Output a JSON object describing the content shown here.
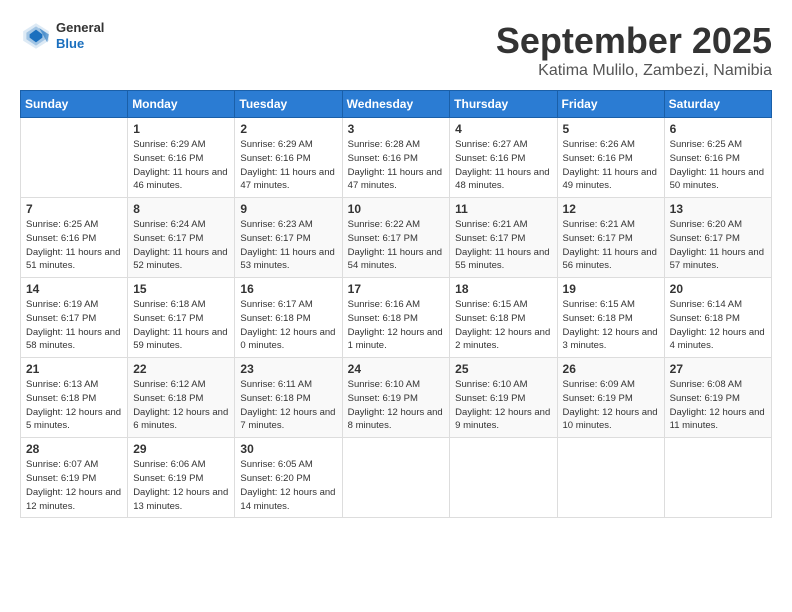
{
  "header": {
    "logo": {
      "general": "General",
      "blue": "Blue"
    },
    "title": "September 2025",
    "subtitle": "Katima Mulilo, Zambezi, Namibia"
  },
  "columns": [
    "Sunday",
    "Monday",
    "Tuesday",
    "Wednesday",
    "Thursday",
    "Friday",
    "Saturday"
  ],
  "weeks": [
    [
      {
        "day": "",
        "sunrise": "",
        "sunset": "",
        "daylight": ""
      },
      {
        "day": "1",
        "sunrise": "Sunrise: 6:29 AM",
        "sunset": "Sunset: 6:16 PM",
        "daylight": "Daylight: 11 hours and 46 minutes."
      },
      {
        "day": "2",
        "sunrise": "Sunrise: 6:29 AM",
        "sunset": "Sunset: 6:16 PM",
        "daylight": "Daylight: 11 hours and 47 minutes."
      },
      {
        "day": "3",
        "sunrise": "Sunrise: 6:28 AM",
        "sunset": "Sunset: 6:16 PM",
        "daylight": "Daylight: 11 hours and 47 minutes."
      },
      {
        "day": "4",
        "sunrise": "Sunrise: 6:27 AM",
        "sunset": "Sunset: 6:16 PM",
        "daylight": "Daylight: 11 hours and 48 minutes."
      },
      {
        "day": "5",
        "sunrise": "Sunrise: 6:26 AM",
        "sunset": "Sunset: 6:16 PM",
        "daylight": "Daylight: 11 hours and 49 minutes."
      },
      {
        "day": "6",
        "sunrise": "Sunrise: 6:25 AM",
        "sunset": "Sunset: 6:16 PM",
        "daylight": "Daylight: 11 hours and 50 minutes."
      }
    ],
    [
      {
        "day": "7",
        "sunrise": "Sunrise: 6:25 AM",
        "sunset": "Sunset: 6:16 PM",
        "daylight": "Daylight: 11 hours and 51 minutes."
      },
      {
        "day": "8",
        "sunrise": "Sunrise: 6:24 AM",
        "sunset": "Sunset: 6:17 PM",
        "daylight": "Daylight: 11 hours and 52 minutes."
      },
      {
        "day": "9",
        "sunrise": "Sunrise: 6:23 AM",
        "sunset": "Sunset: 6:17 PM",
        "daylight": "Daylight: 11 hours and 53 minutes."
      },
      {
        "day": "10",
        "sunrise": "Sunrise: 6:22 AM",
        "sunset": "Sunset: 6:17 PM",
        "daylight": "Daylight: 11 hours and 54 minutes."
      },
      {
        "day": "11",
        "sunrise": "Sunrise: 6:21 AM",
        "sunset": "Sunset: 6:17 PM",
        "daylight": "Daylight: 11 hours and 55 minutes."
      },
      {
        "day": "12",
        "sunrise": "Sunrise: 6:21 AM",
        "sunset": "Sunset: 6:17 PM",
        "daylight": "Daylight: 11 hours and 56 minutes."
      },
      {
        "day": "13",
        "sunrise": "Sunrise: 6:20 AM",
        "sunset": "Sunset: 6:17 PM",
        "daylight": "Daylight: 11 hours and 57 minutes."
      }
    ],
    [
      {
        "day": "14",
        "sunrise": "Sunrise: 6:19 AM",
        "sunset": "Sunset: 6:17 PM",
        "daylight": "Daylight: 11 hours and 58 minutes."
      },
      {
        "day": "15",
        "sunrise": "Sunrise: 6:18 AM",
        "sunset": "Sunset: 6:17 PM",
        "daylight": "Daylight: 11 hours and 59 minutes."
      },
      {
        "day": "16",
        "sunrise": "Sunrise: 6:17 AM",
        "sunset": "Sunset: 6:18 PM",
        "daylight": "Daylight: 12 hours and 0 minutes."
      },
      {
        "day": "17",
        "sunrise": "Sunrise: 6:16 AM",
        "sunset": "Sunset: 6:18 PM",
        "daylight": "Daylight: 12 hours and 1 minute."
      },
      {
        "day": "18",
        "sunrise": "Sunrise: 6:15 AM",
        "sunset": "Sunset: 6:18 PM",
        "daylight": "Daylight: 12 hours and 2 minutes."
      },
      {
        "day": "19",
        "sunrise": "Sunrise: 6:15 AM",
        "sunset": "Sunset: 6:18 PM",
        "daylight": "Daylight: 12 hours and 3 minutes."
      },
      {
        "day": "20",
        "sunrise": "Sunrise: 6:14 AM",
        "sunset": "Sunset: 6:18 PM",
        "daylight": "Daylight: 12 hours and 4 minutes."
      }
    ],
    [
      {
        "day": "21",
        "sunrise": "Sunrise: 6:13 AM",
        "sunset": "Sunset: 6:18 PM",
        "daylight": "Daylight: 12 hours and 5 minutes."
      },
      {
        "day": "22",
        "sunrise": "Sunrise: 6:12 AM",
        "sunset": "Sunset: 6:18 PM",
        "daylight": "Daylight: 12 hours and 6 minutes."
      },
      {
        "day": "23",
        "sunrise": "Sunrise: 6:11 AM",
        "sunset": "Sunset: 6:18 PM",
        "daylight": "Daylight: 12 hours and 7 minutes."
      },
      {
        "day": "24",
        "sunrise": "Sunrise: 6:10 AM",
        "sunset": "Sunset: 6:19 PM",
        "daylight": "Daylight: 12 hours and 8 minutes."
      },
      {
        "day": "25",
        "sunrise": "Sunrise: 6:10 AM",
        "sunset": "Sunset: 6:19 PM",
        "daylight": "Daylight: 12 hours and 9 minutes."
      },
      {
        "day": "26",
        "sunrise": "Sunrise: 6:09 AM",
        "sunset": "Sunset: 6:19 PM",
        "daylight": "Daylight: 12 hours and 10 minutes."
      },
      {
        "day": "27",
        "sunrise": "Sunrise: 6:08 AM",
        "sunset": "Sunset: 6:19 PM",
        "daylight": "Daylight: 12 hours and 11 minutes."
      }
    ],
    [
      {
        "day": "28",
        "sunrise": "Sunrise: 6:07 AM",
        "sunset": "Sunset: 6:19 PM",
        "daylight": "Daylight: 12 hours and 12 minutes."
      },
      {
        "day": "29",
        "sunrise": "Sunrise: 6:06 AM",
        "sunset": "Sunset: 6:19 PM",
        "daylight": "Daylight: 12 hours and 13 minutes."
      },
      {
        "day": "30",
        "sunrise": "Sunrise: 6:05 AM",
        "sunset": "Sunset: 6:20 PM",
        "daylight": "Daylight: 12 hours and 14 minutes."
      },
      {
        "day": "",
        "sunrise": "",
        "sunset": "",
        "daylight": ""
      },
      {
        "day": "",
        "sunrise": "",
        "sunset": "",
        "daylight": ""
      },
      {
        "day": "",
        "sunrise": "",
        "sunset": "",
        "daylight": ""
      },
      {
        "day": "",
        "sunrise": "",
        "sunset": "",
        "daylight": ""
      }
    ]
  ]
}
